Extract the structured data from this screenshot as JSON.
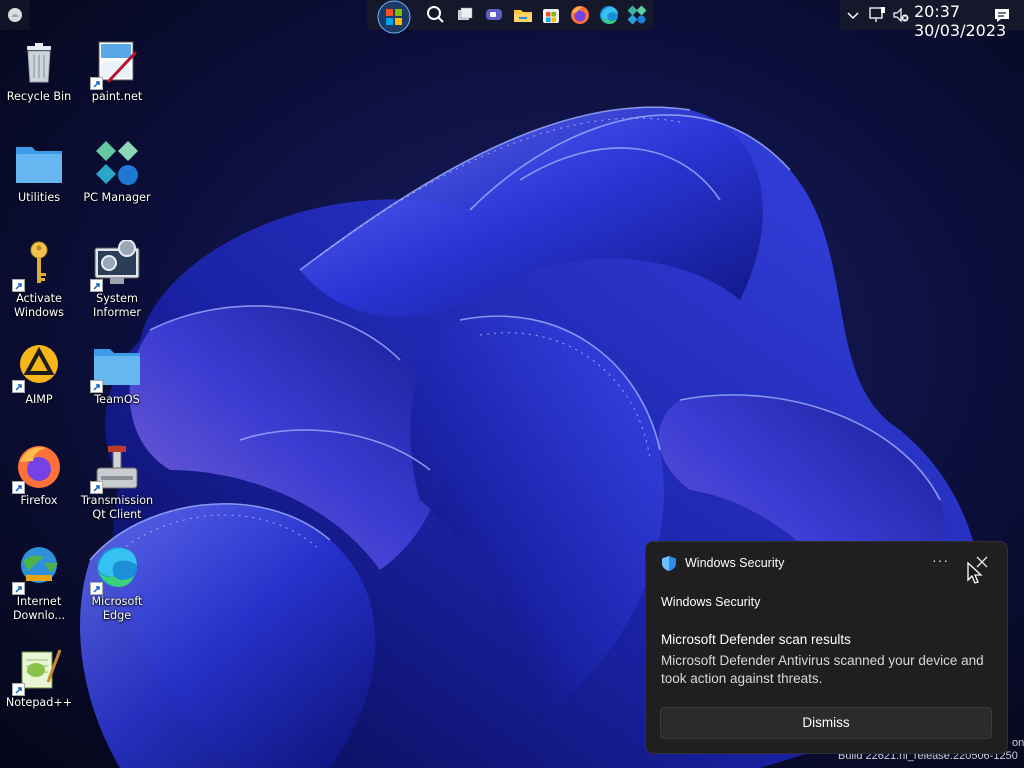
{
  "taskbar": {
    "clock_time": "20:37",
    "clock_date": "30/03/2023",
    "pinned_icons": [
      "start-orb-icon",
      "search-icon",
      "task-view-icon",
      "chat-icon",
      "file-explorer-icon",
      "store-icon",
      "firefox-icon",
      "edge-icon",
      "pc-manager-icon"
    ],
    "tray_icons": [
      "chevron-up-icon",
      "network-icon",
      "volume-muted-icon",
      "notification-icon"
    ]
  },
  "desktop": {
    "icons": [
      {
        "id": "recycle-bin",
        "label": "Recycle Bin",
        "icon": "recycle-bin-icon"
      },
      {
        "id": "paint-net",
        "label": "paint.net",
        "icon": "paint-net-icon"
      },
      {
        "id": "utilities",
        "label": "Utilities",
        "icon": "folder-icon"
      },
      {
        "id": "pc-manager",
        "label": "PC Manager",
        "icon": "pc-manager-icon"
      },
      {
        "id": "activate-windows",
        "label": "Activate\nWindows",
        "icon": "key-icon"
      },
      {
        "id": "system-informer",
        "label": "System\nInformer",
        "icon": "system-informer-icon"
      },
      {
        "id": "aimp",
        "label": "AIMP",
        "icon": "aimp-icon"
      },
      {
        "id": "teamos",
        "label": "TeamOS",
        "icon": "folder-icon"
      },
      {
        "id": "firefox",
        "label": "Firefox",
        "icon": "firefox-icon"
      },
      {
        "id": "transmission",
        "label": "Transmission\nQt Client",
        "icon": "transmission-icon"
      },
      {
        "id": "idm",
        "label": "Internet\nDownlo...",
        "icon": "idm-icon"
      },
      {
        "id": "edge",
        "label": "Microsoft\nEdge",
        "icon": "edge-icon"
      },
      {
        "id": "notepadpp",
        "label": "Notepad++",
        "icon": "notepadpp-icon"
      }
    ]
  },
  "toast": {
    "app_name": "Windows Security",
    "header": "Windows Security",
    "title": "Microsoft Defender scan results",
    "body": "Microsoft Defender Antivirus scanned your device and took action against threats.",
    "more_label": "···",
    "dismiss_label": "Dismiss"
  },
  "watermark": {
    "line2": "Build 22621.ni_release.220506-1250",
    "line1_fragment": "on"
  },
  "colors": {
    "taskbar_bg": "#15172b",
    "toast_bg": "#1f1f22",
    "wallpaper_dark": "#070a24",
    "wallpaper_blue": "#2b3ee0"
  }
}
